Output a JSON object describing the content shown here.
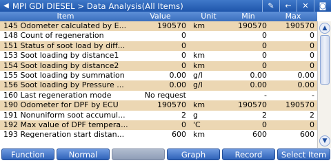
{
  "titlebar": {
    "path": "MPI   GDI   DIESEL > Data Analysis(All Items)",
    "icons": [
      "pencil-icon",
      "back-arrow-icon",
      "close-icon",
      "camera-icon"
    ]
  },
  "columns": {
    "item": "Item",
    "value": "Value",
    "unit": "Unit",
    "min": "Min",
    "max": "Max"
  },
  "rows": [
    {
      "item": "145 Odometer calculated by E...",
      "value": "190570",
      "unit": "km",
      "min": "190570",
      "max": "190570"
    },
    {
      "item": "148 Count of regeneration",
      "value": "0",
      "unit": "",
      "min": "0",
      "max": "0"
    },
    {
      "item": "151 Status of soot load by diff...",
      "value": "0",
      "unit": "",
      "min": "0",
      "max": "0"
    },
    {
      "item": "153 Soot loading by distance1",
      "value": "0",
      "unit": "km",
      "min": "0",
      "max": "0"
    },
    {
      "item": "154 Soot loading by distance2",
      "value": "0",
      "unit": "km",
      "min": "0",
      "max": "0"
    },
    {
      "item": "155 Soot loading by summation",
      "value": "0.00",
      "unit": "g/l",
      "min": "0.00",
      "max": "0.00"
    },
    {
      "item": "156 Soot loading by Pressure ...",
      "value": "0.00",
      "unit": "g/l",
      "min": "0.00",
      "max": "0.00"
    },
    {
      "item": "160 Last regeneration mode",
      "value": "No request",
      "unit": "",
      "min": "-",
      "max": "-"
    },
    {
      "item": "190 Odometer for DPF by ECU",
      "value": "190570",
      "unit": "km",
      "min": "190570",
      "max": "190570"
    },
    {
      "item": "191 Nonuniform soot accumul...",
      "value": "2",
      "unit": "g",
      "min": "2",
      "max": "2"
    },
    {
      "item": "192 Max value of DPF tempera...",
      "value": "0",
      "unit": "'C",
      "min": "0",
      "max": "0"
    },
    {
      "item": "193 Regeneration start distan...",
      "value": "600",
      "unit": "km",
      "min": "600",
      "max": "600"
    }
  ],
  "scrollbar": {
    "up_icon": "arrow-up-icon",
    "down_icon": "arrow-down-icon"
  },
  "footer": {
    "buttons": [
      "Function",
      "Normal",
      "",
      "Graph",
      "Record",
      "Select Item"
    ]
  }
}
